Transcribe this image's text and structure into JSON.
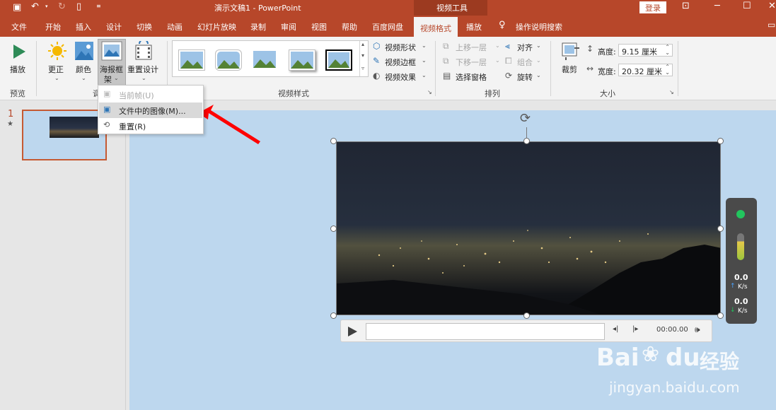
{
  "titlebar": {
    "doc_title": "演示文稿1  -  PowerPoint",
    "context_tool": "视频工具",
    "login": "登录"
  },
  "tabs": {
    "file": "文件",
    "home": "开始",
    "insert": "插入",
    "design": "设计",
    "transitions": "切换",
    "animations": "动画",
    "slideshow": "幻灯片放映",
    "record": "录制",
    "review": "审阅",
    "view": "视图",
    "help": "帮助",
    "baidu": "百度网盘",
    "video_format": "视频格式",
    "playback": "播放",
    "tell_me": "操作说明搜索"
  },
  "ribbon": {
    "play": "播放",
    "group_preview": "预览",
    "corrections": "更正",
    "color": "颜色",
    "poster_frame_1": "海报框",
    "poster_frame_2": "架",
    "reset_design": "重置设计",
    "group_adjust_partial": "调",
    "group_video_styles": "视频样式",
    "video_shape": "视频形状",
    "video_border": "视频边框",
    "video_effects": "视频效果",
    "bring_forward": "上移一层",
    "send_backward": "下移一层",
    "selection_pane": "选择窗格",
    "align": "对齐",
    "group": "组合",
    "rotate": "旋转",
    "group_arrange": "排列",
    "crop": "裁剪",
    "height_label": "高度:",
    "height_value": "9.15 厘米",
    "width_label": "宽度:",
    "width_value": "20.32 厘米",
    "group_size": "大小"
  },
  "dropdown": {
    "current_frame": "当前帧(U)",
    "image_from_file": "文件中的图像(M)...",
    "reset": "重置(R)"
  },
  "thumbnail": {
    "number": "1",
    "star": "★"
  },
  "player": {
    "time": "00:00.00"
  },
  "net_widget": {
    "up_value": "0.0",
    "up_unit": "K/s",
    "down_value": "0.0",
    "down_unit": "K/s"
  },
  "watermark": {
    "brand": "Bai",
    "brand2": "du",
    "cn": "经验",
    "url": "jingyan.baidu.com"
  },
  "colors": {
    "accent": "#b7472a",
    "slide_bg": "#bdd7ee",
    "arrow": "#ff0000",
    "menu_highlight": "#d9d9d9"
  }
}
